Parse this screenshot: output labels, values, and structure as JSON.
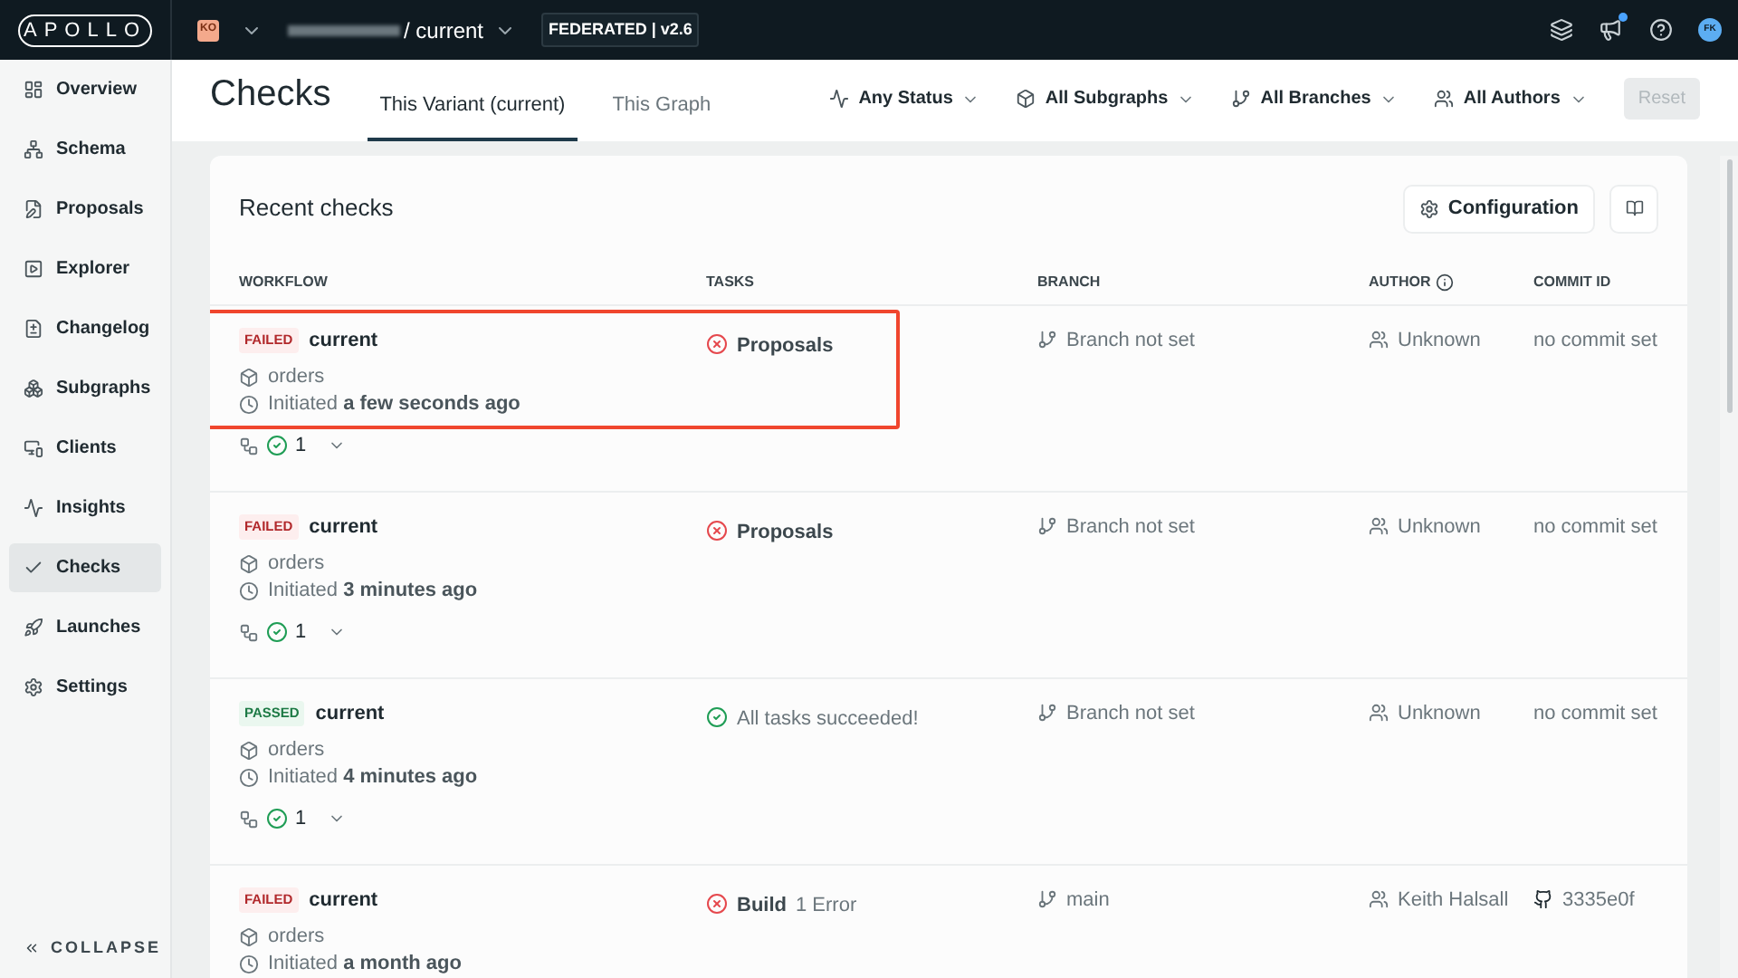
{
  "topbar": {
    "logo": "APOLLO",
    "org_badge": "KO",
    "graph_variant": "/ current",
    "federation_tag": "FEDERATED | v2.6",
    "notification_dot": true,
    "avatar": "FK"
  },
  "sidebar": {
    "items": [
      {
        "label": "Overview",
        "selected": false
      },
      {
        "label": "Schema",
        "selected": false
      },
      {
        "label": "Proposals",
        "selected": false
      },
      {
        "label": "Explorer",
        "selected": false
      },
      {
        "label": "Changelog",
        "selected": false
      },
      {
        "label": "Subgraphs",
        "selected": false
      },
      {
        "label": "Clients",
        "selected": false
      },
      {
        "label": "Insights",
        "selected": false
      },
      {
        "label": "Checks",
        "selected": true
      },
      {
        "label": "Launches",
        "selected": false
      },
      {
        "label": "Settings",
        "selected": false
      }
    ],
    "collapse": "COLLAPSE"
  },
  "header": {
    "title": "Checks",
    "tabs": [
      {
        "label": "This Variant (current)",
        "selected": true
      },
      {
        "label": "This Graph",
        "selected": false
      }
    ],
    "filters": [
      "Any Status",
      "All Subgraphs",
      "All Branches",
      "All Authors"
    ],
    "reset": {
      "label": "Reset",
      "disabled": true
    }
  },
  "card": {
    "title": "Recent checks",
    "configuration": "Configuration",
    "columns": [
      "WORKFLOW",
      "TASKS",
      "BRANCH",
      "AUTHOR",
      "COMMIT ID"
    ],
    "rows": [
      {
        "status": "FAILED",
        "kind": "failed",
        "name": "current",
        "subgraph": "orders",
        "initiated_label": "Initiated",
        "initiated": "a few seconds ago",
        "count": "1",
        "highlighted": true,
        "task": {
          "kind": "error",
          "label": "Proposals"
        },
        "branch": "Branch not set",
        "author": "Unknown",
        "commit": {
          "kind": "none",
          "label": "no commit set"
        }
      },
      {
        "status": "FAILED",
        "kind": "failed",
        "name": "current",
        "subgraph": "orders",
        "initiated_label": "Initiated",
        "initiated": "3 minutes ago",
        "count": "1",
        "highlighted": false,
        "task": {
          "kind": "error",
          "label": "Proposals"
        },
        "branch": "Branch not set",
        "author": "Unknown",
        "commit": {
          "kind": "none",
          "label": "no commit set"
        }
      },
      {
        "status": "PASSED",
        "kind": "passed",
        "name": "current",
        "subgraph": "orders",
        "initiated_label": "Initiated",
        "initiated": "4 minutes ago",
        "count": "1",
        "highlighted": false,
        "task": {
          "kind": "success",
          "label": "All tasks succeeded!"
        },
        "branch": "Branch not set",
        "author": "Unknown",
        "commit": {
          "kind": "none",
          "label": "no commit set"
        }
      },
      {
        "status": "FAILED",
        "kind": "failed",
        "name": "current",
        "subgraph": "orders",
        "initiated_label": "Initiated",
        "initiated": "a month ago",
        "highlighted": false,
        "task": {
          "kind": "error",
          "label": "Build",
          "detail": "1 Error"
        },
        "branch": "main",
        "author": "Keith Halsall",
        "commit": {
          "kind": "github",
          "label": "3335e0f"
        }
      }
    ]
  }
}
